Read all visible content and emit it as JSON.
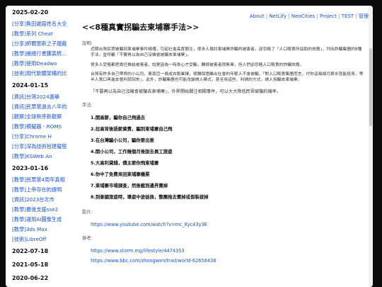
{
  "nav": {
    "items": [
      "About",
      "NetLify",
      "NeoCities",
      "Project",
      "TEST",
      "管理"
    ]
  },
  "sidebar": {
    "groups": [
      {
        "date": "2025-02-20",
        "items": [
          "[分享]魚田謝菇姓名大全",
          "[教學]系列 Cheat",
          "[分享]師爾墨斯之子獵戴",
          "[教學]繪總行書獲裝統...",
          "[教學]使用Deadwo",
          "[技術]現代軟體架構的比"
        ]
      },
      {
        "date": "2024-01-15",
        "items": [
          "[資訊]台灣2024選舉",
          "[資訊]民眾黨過去八年的",
          "[觀察]全球秩序新觀察",
          "[教學]模擬器 - ROMS",
          "[分享]Chrome H",
          "[分享]深為技術拾建擬態",
          "[教學]KSWeb An"
        ]
      },
      {
        "date": "2023-01-16",
        "items": [
          "[教學]民眾黨4周年真相",
          "[教學]上帝存在的證明",
          "[資訊]2023台北市",
          "[教學]最後支援sse2",
          "[教學]運用AI圖像生成",
          "[教學]3ds Max",
          "[技術]LibreOff"
        ]
      },
      {
        "date": "2022-07-18",
        "items": []
      },
      {
        "date": "2021-05-18",
        "items": []
      },
      {
        "date": "2020-06-22",
        "items": []
      }
    ]
  },
  "article": {
    "title": "<<8種真實拐騙去柬埔寨手法>>",
    "intro_label": "說明:",
    "paragraphs": [
      "近期台灣民眾被騙到柬埔寨事件頻傳，引起社會高度關注，很多人倫討柬埔寨詐騙的被害者，卻忽略了「人口販賣所協助的效應」，列出詐騙集團的8種手法，並呼籲「不要再以為自己沒機會被騙去柬埔寨」。",
      "很多人受冤都把責任推給被害者，說是因為一時貪心才受騙，轉嫁被害者很無辜，但人們卻忽略人口販賣的詐騙效應。",
      "台灣有許多自己帶貨的小公司，東南亞一條成衣製業鏈，很難保證離出社會的年輕人不會被騙，「對人口販賣集團而言，付你這幾個月薪水就能投資，等半人賣口再進本營利就回來」，此外，詐騙集團也可能改變誘人模式，甚至用這些、利誘的方式，誘人拐騙去柬埔寨。"
    ],
    "quote": "「不要再以為自己沒機會被騙去柬埔寨」，外界開始關注相關事件，可以大大降低民眾被騙的機率。",
    "tips_label": "手法:",
    "tips": [
      "1.開高薪，騙你自己飛過去",
      "2.拉高背後語薪資費，騙到柬埔寨自己飛",
      "3.在台灣騙小公司，騙你要出差",
      "4.開小公司，工作幾個月後說去員工旅遊",
      "5.大高利貸錢，債主要你飛柬埔寨",
      "6.你中了免費來回柬埔寨機票",
      "7.柬埔寨市場調查，然後載到邊界賣掉",
      "8.到泰國旅遊時，導遊中途徙換，整團拖去賣掉或假裝拔掉"
    ],
    "video_label": "影片:",
    "video_url": "https://www.youtube.com/watch?v=mc_Kyc43y3E",
    "ref_label": "參考:",
    "ref_urls": [
      "https://www.storm.mg/lifestyle/4474353",
      "https://www.bbc.com/zhongwen/trad/world-62658438"
    ]
  }
}
